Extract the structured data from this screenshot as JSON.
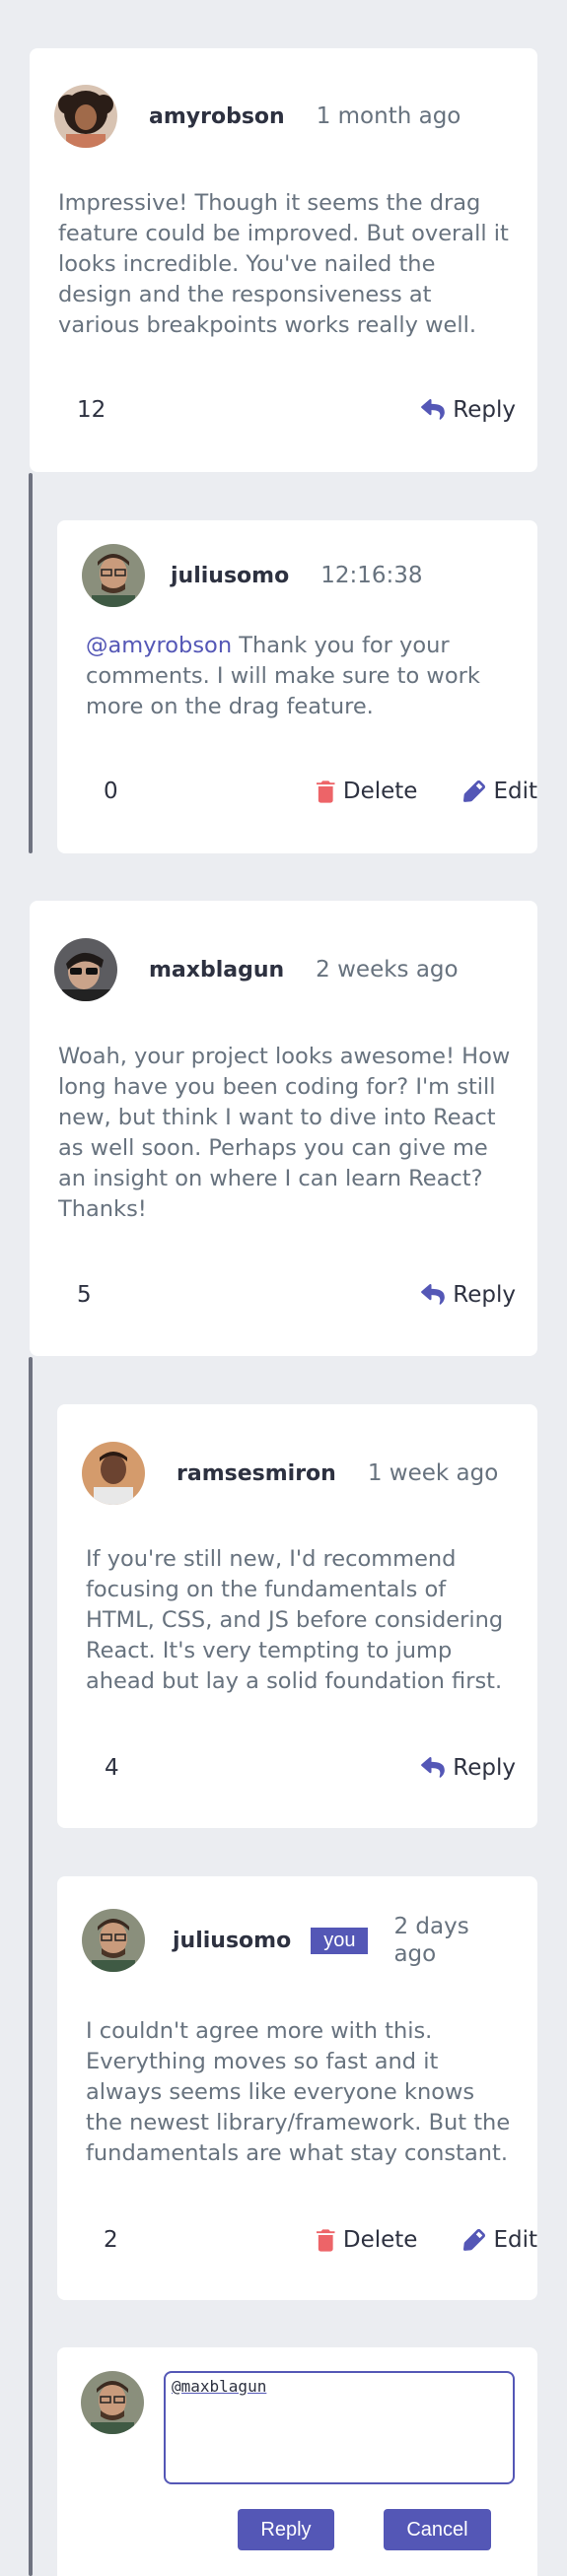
{
  "colors": {
    "background": "#ebedf1",
    "card": "#ffffff",
    "accent": "#5457b6",
    "danger": "#ed6468",
    "text_dark": "#2d3140",
    "text_muted": "#67727e",
    "thread_line": "#6f7380"
  },
  "icons": {
    "reply": "reply-arrow-icon",
    "delete": "trash-icon",
    "edit": "pencil-icon"
  },
  "comments": [
    {
      "username": "amyrobson",
      "time": "1 month ago",
      "body": "Impressive! Though it seems the drag feature could be improved. But overall it looks incredible. You've nailed the design and the responsiveness at various breakpoints works really well.",
      "score": "12",
      "reply_label": "Reply"
    },
    {
      "username": "juliusomo",
      "time": "12:16:38",
      "mention": "@amyrobson",
      "body": " Thank you for your comments. I will make sure to work more on the drag feature.",
      "score": "0",
      "delete_label": "Delete",
      "edit_label": "Edit"
    },
    {
      "username": "maxblagun",
      "time": "2 weeks ago",
      "body": "Woah, your project looks awesome! How long have you been coding for? I'm still new, but think I want to dive into React as well soon. Perhaps you can give me an insight on where I can learn React? Thanks!",
      "score": "5",
      "reply_label": "Reply"
    },
    {
      "username": "ramsesmiron",
      "time": "1 week ago",
      "body": "If you're still new, I'd recommend focusing on the fundamentals of HTML, CSS, and JS before considering React. It's very tempting to jump ahead but lay a solid foundation first.",
      "score": "4",
      "reply_label": "Reply"
    },
    {
      "username": "juliusomo",
      "badge": "you",
      "time": "2 days ago",
      "body": "I couldn't agree more with this. Everything moves so fast and it always seems like everyone knows the newest library/framework. But the fundamentals are what stay constant.",
      "score": "2",
      "delete_label": "Delete",
      "edit_label": "Edit"
    }
  ],
  "reply_form": {
    "value": "@maxblagun",
    "reply_button": "Reply",
    "cancel_button": "Cancel"
  }
}
